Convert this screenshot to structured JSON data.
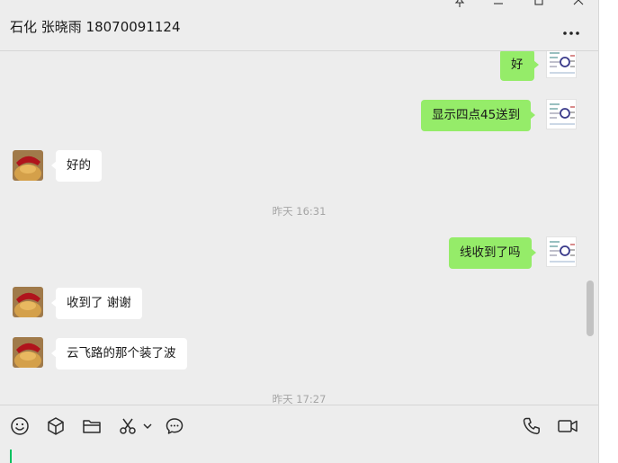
{
  "chat": {
    "title": "石化 张晓雨 18070091124"
  },
  "messages": [
    {
      "direction": "out",
      "text": "好"
    },
    {
      "direction": "out",
      "text": "显示四点45送到"
    },
    {
      "direction": "in",
      "text": "好的"
    },
    {
      "timestamp": "昨天 16:31"
    },
    {
      "direction": "out",
      "text": "线收到了吗"
    },
    {
      "direction": "in",
      "text": "收到了 谢谢"
    },
    {
      "direction": "in",
      "text": "云飞路的那个装了波"
    },
    {
      "timestamp": "昨天 17:27"
    }
  ],
  "toolbar": {
    "left_icons": [
      "emoji-icon",
      "cube-icon",
      "folder-icon",
      "scissors-icon",
      "chevron-down-icon",
      "chat-bubble-icon"
    ],
    "right_icons": [
      "phone-icon",
      "video-icon"
    ]
  },
  "colors": {
    "outgoing_bubble": "#95ec69",
    "incoming_bubble": "#ffffff",
    "background": "#ededed",
    "caret": "#07c160"
  }
}
